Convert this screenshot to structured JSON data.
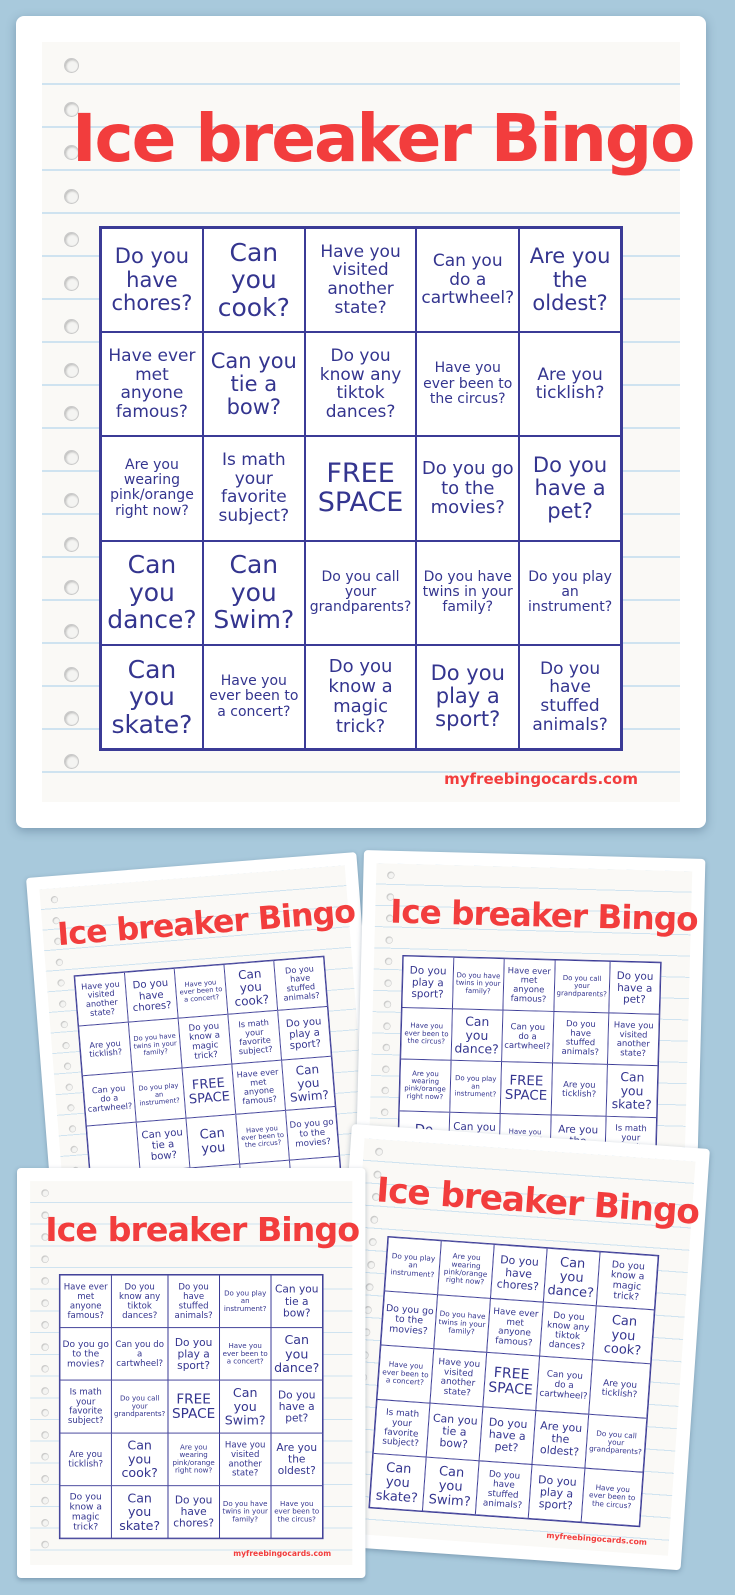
{
  "colors": {
    "background": "#a8c9dc",
    "title": "#f23d3d",
    "grid": "#3b3b96",
    "text": "#34358f"
  },
  "cards": [
    {
      "title": "Ice breaker Bingo",
      "footer": "myfreebingocards.com",
      "cells": [
        "Do you have chores?",
        "Can you cook?",
        "Have you visited another state?",
        "Can you do a cartwheel?",
        "Are you the oldest?",
        "Have ever met anyone famous?",
        "Can you tie a bow?",
        "Do you know any tiktok dances?",
        "Have you ever been to the circus?",
        "Are you ticklish?",
        "Are you wearing pink/orange right now?",
        "Is math your favorite subject?",
        "FREE SPACE",
        "Do you go to the movies?",
        "Do you have a pet?",
        "Can you dance?",
        "Can you Swim?",
        "Do you call your grandparents?",
        "Do you have twins in your family?",
        "Do you play an instrument?",
        "Can you skate?",
        "Have you ever been to a concert?",
        "Do you know a magic trick?",
        "Do you play a sport?",
        "Do you have stuffed animals?"
      ]
    },
    {
      "title": "Ice breaker Bingo",
      "footer": "myfreebingocards.com",
      "cells": [
        "Have you visited another state?",
        "Do you have chores?",
        "Have you ever been to a concert?",
        "Can you cook?",
        "Do you have stuffed animals?",
        "Are you ticklish?",
        "Do you have twins in your family?",
        "Do you know a magic trick?",
        "Is math your favorite subject?",
        "Do you play a sport?",
        "Can you do a cartwheel?",
        "Do you play an instrument?",
        "FREE SPACE",
        "Have ever met anyone famous?",
        "Can you Swim?",
        "",
        "Can you tie a bow?",
        "Can you",
        "Have you ever been to the circus?",
        "Do you go to the movies?",
        "",
        "",
        "",
        "",
        ""
      ]
    },
    {
      "title": "Ice breaker Bingo",
      "footer": "myfreebingocards.com",
      "cells": [
        "Do you play a sport?",
        "Do you have twins in your family?",
        "Have ever met anyone famous?",
        "Do you call your grandparents?",
        "Do you have a pet?",
        "Have you ever been to the circus?",
        "Can you dance?",
        "Can you do a cartwheel?",
        "Do you have stuffed animals?",
        "Have you visited another state?",
        "Are you wearing pink/orange right now?",
        "Do you play an instrument?",
        "FREE SPACE",
        "Are you ticklish?",
        "Can you skate?",
        "Do you",
        "Can you tie a bow?",
        "Have you ever been to a concert?",
        "Are you the oldest?",
        "Is math your favorite subject?",
        "",
        "",
        "",
        "",
        ""
      ]
    },
    {
      "title": "Ice breaker Bingo",
      "footer": "myfreebingocards.com",
      "cells": [
        "Have ever met anyone famous?",
        "Do you know any tiktok dances?",
        "Do you have stuffed animals?",
        "Do you play an instrument?",
        "Can you tie a bow?",
        "Do you go to the movies?",
        "Can you do a cartwheel?",
        "Do you play a sport?",
        "Have you ever been to a concert?",
        "Can you dance?",
        "Is math your favorite subject?",
        "Do you call your grandparents?",
        "FREE SPACE",
        "Can you Swim?",
        "Do you have a pet?",
        "Are you ticklish?",
        "Can you cook?",
        "Are you wearing pink/orange right now?",
        "Have you visited another state?",
        "Are you the oldest?",
        "Do you know a magic trick?",
        "Can you skate?",
        "Do you have chores?",
        "Do you have twins in your family?",
        "Have you ever been to the circus?"
      ]
    },
    {
      "title": "Ice breaker Bingo",
      "footer": "myfreebingocards.com",
      "cells": [
        "Do you play an instrument?",
        "Are you wearing pink/orange right now?",
        "Do you have chores?",
        "Can you dance?",
        "Do you know a magic trick?",
        "Do you go to the movies?",
        "Do you have twins in your family?",
        "Have ever met anyone famous?",
        "Do you know any tiktok dances?",
        "Can you cook?",
        "Have you ever been to a concert?",
        "Have you visited another state?",
        "FREE SPACE",
        "Can you do a cartwheel?",
        "Are you ticklish?",
        "Is math your favorite subject?",
        "Can you tie a bow?",
        "Do you have a pet?",
        "Are you the oldest?",
        "Do you call your grandparents?",
        "Can you skate?",
        "Can you Swim?",
        "Do you have stuffed animals?",
        "Do you play a sport?",
        "Have you ever been to the circus?"
      ]
    }
  ]
}
